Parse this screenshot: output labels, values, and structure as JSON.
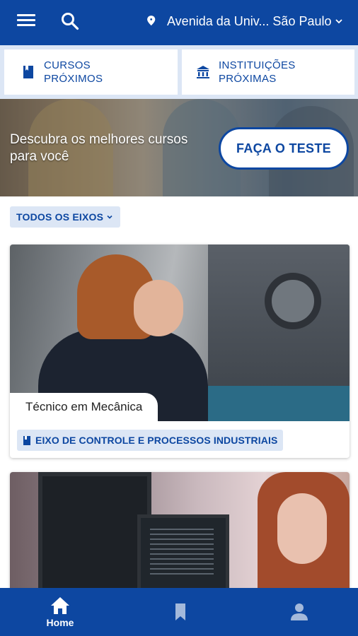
{
  "header": {
    "menu_icon": "menu-icon",
    "search_icon": "search-icon",
    "location": "Avenida da Univ... São Paulo",
    "location_icon": "location-pin-icon"
  },
  "quick_links": {
    "nearby_courses": "CURSOS PRÓXIMOS",
    "nearby_institutions": "INSTITUIÇÕES PRÓXIMAS"
  },
  "banner": {
    "text": "Descubra os melhores cursos para você",
    "button": "FAÇA O TESTE"
  },
  "filter": {
    "label": "TODOS OS EIXOS"
  },
  "courses": [
    {
      "title": "Técnico em Mecânica",
      "eixo": "EIXO DE CONTROLE E PROCESSOS INDUSTRIAIS"
    }
  ],
  "bottom_nav": {
    "home_label": "Home",
    "saved_icon": "bookmark-icon",
    "profile_icon": "person-icon"
  },
  "colors": {
    "primary": "#0d47a1",
    "chip_bg": "#dce6f5",
    "white": "#ffffff"
  }
}
